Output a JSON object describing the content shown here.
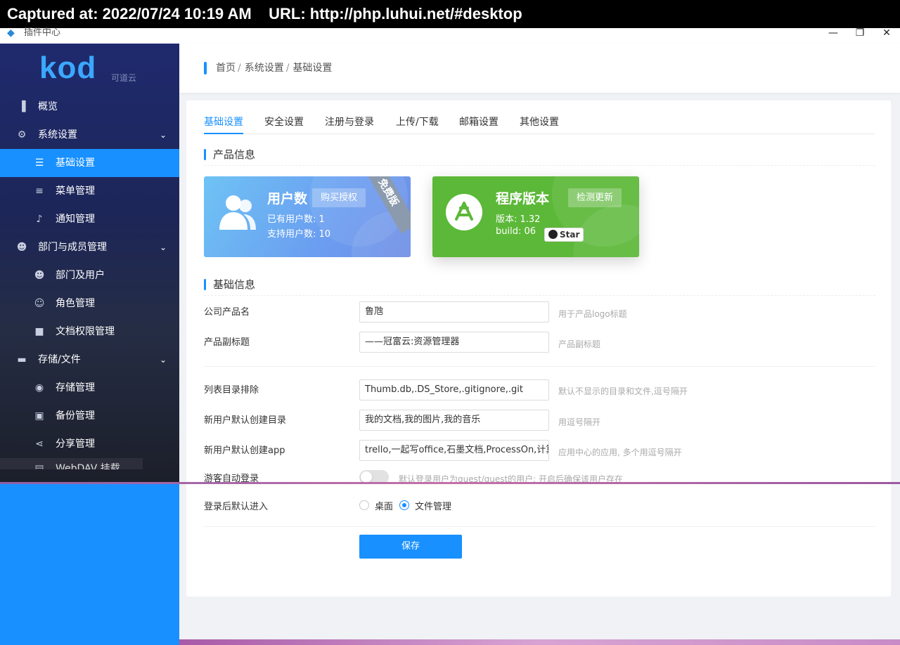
{
  "capture": {
    "text": "Captured at: 2022/07/24 10:19 AM    URL: http://php.luhui.net/#desktop"
  },
  "window": {
    "title": "插件中心",
    "minimize": "—",
    "restore": "❐",
    "close": "✕"
  },
  "logo": {
    "brand": "kod",
    "sub": "可道云"
  },
  "sidebar": {
    "items": [
      {
        "label": "概览",
        "icon": "bar-chart-icon",
        "glyph": "▮"
      },
      {
        "label": "系统设置",
        "icon": "gear-icon",
        "glyph": "✸"
      },
      {
        "label": "基础设置",
        "icon": "sliders-icon",
        "glyph": "☰"
      },
      {
        "label": "菜单管理",
        "icon": "menu-icon",
        "glyph": "≡"
      },
      {
        "label": "通知管理",
        "icon": "bell-icon",
        "glyph": "🔔"
      },
      {
        "label": "部门与成员管理",
        "icon": "users-icon",
        "glyph": "👥"
      },
      {
        "label": "部门及用户",
        "icon": "users-icon",
        "glyph": "👥"
      },
      {
        "label": "角色管理",
        "icon": "user-badge-icon",
        "glyph": "👤"
      },
      {
        "label": "文档权限管理",
        "icon": "lock-icon",
        "glyph": "🔒"
      },
      {
        "label": "存储/文件",
        "icon": "folder-icon",
        "glyph": "▬"
      },
      {
        "label": "存储管理",
        "icon": "database-icon",
        "glyph": "◎"
      },
      {
        "label": "备份管理",
        "icon": "backup-icon",
        "glyph": "▣"
      },
      {
        "label": "分享管理",
        "icon": "share-icon",
        "glyph": "⋖"
      },
      {
        "label": "WebDAV 挂载",
        "icon": "webdav-icon",
        "glyph": "▤"
      }
    ]
  },
  "breadcrumb": {
    "home": "首页",
    "level1": "系统设置",
    "level2": "基础设置",
    "sep": "/"
  },
  "tabs": [
    "基础设置",
    "安全设置",
    "注册与登录",
    "上传/下载",
    "邮箱设置",
    "其他设置"
  ],
  "product": {
    "section_title": "产品信息",
    "users_card": {
      "title": "用户数",
      "button": "购买授权",
      "line1": "已有用户数:  1",
      "line2": "支持用户数:  10",
      "ribbon": "免费版"
    },
    "version_card": {
      "title": "程序版本",
      "button": "检测更新",
      "line1": "版本:  1.32",
      "line2": "build:  06",
      "star": "Star"
    }
  },
  "basic": {
    "section_title": "基础信息",
    "rows": [
      {
        "label": "公司产品名",
        "value": "鲁虺",
        "hint": "用于产品logo标题"
      },
      {
        "label": "产品副标题",
        "value": "——冠富云:资源管理器",
        "hint": "产品副标题"
      },
      {
        "label": "列表目录排除",
        "value": "Thumb.db,.DS_Store,.gitignore,.git",
        "hint": "默认不显示的目录和文件,逗号隔开"
      },
      {
        "label": "新用户默认创建目录",
        "value": "我的文档,我的图片,我的音乐",
        "hint": "用逗号隔开"
      },
      {
        "label": "新用户默认创建app",
        "value": "trello,一起写office,石墨文档,ProcessOn,计算器",
        "hint": "应用中心的应用, 多个用逗号隔开"
      },
      {
        "label": "游客自动登录",
        "hint": "默认登录用户为guest/guest的用户; 开启后确保该用户存在"
      }
    ],
    "entry": {
      "label": "登录后默认进入",
      "option1": "桌面",
      "option2": "文件管理",
      "selected": "文件管理"
    },
    "save": "保存"
  }
}
